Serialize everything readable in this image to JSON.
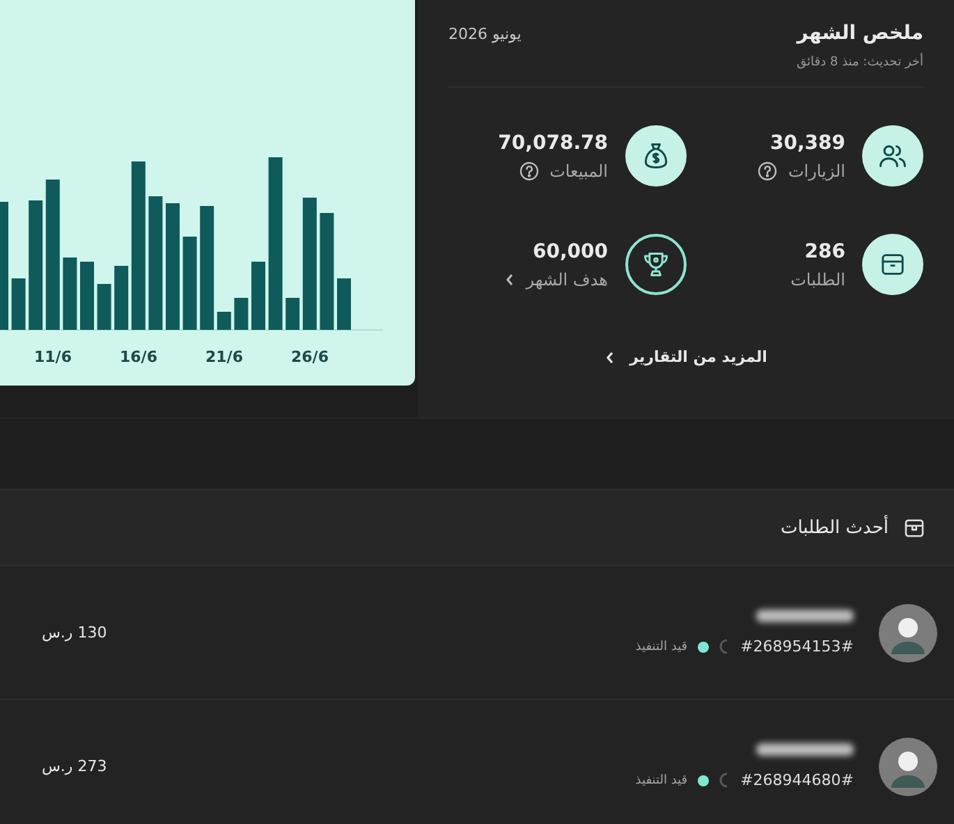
{
  "chart": {
    "axis_labels": [
      "26/6",
      "21/6",
      "16/6",
      "11/6"
    ]
  },
  "summary": {
    "title": "ملخص الشهر",
    "updated": "أخر تحديث: منذ 8 دقائق",
    "period": "يونيو 2026",
    "stats": [
      {
        "kind": "visits",
        "value": "30,389",
        "label": "الزيارات",
        "hint": true
      },
      {
        "kind": "sales",
        "value": "70,078.78",
        "label": "المبيعات",
        "hint": true
      },
      {
        "kind": "orders",
        "value": "286",
        "label": "الطلبات"
      },
      {
        "kind": "goal",
        "value": "60,000",
        "label": "هدف الشهر"
      }
    ],
    "more_link": "المزيد من التقارير"
  },
  "latest_orders": {
    "title": "أحدث الطلبات",
    "orders": [
      {
        "number": "#268954153#",
        "status": "قيد التنفيذ",
        "color": "#7ee8d2",
        "amount": "130 ر.س"
      },
      {
        "number": "#268944680#",
        "status": "قيد التنفيذ",
        "color": "#7ee8d2",
        "amount": "273 ر.س"
      }
    ]
  }
}
